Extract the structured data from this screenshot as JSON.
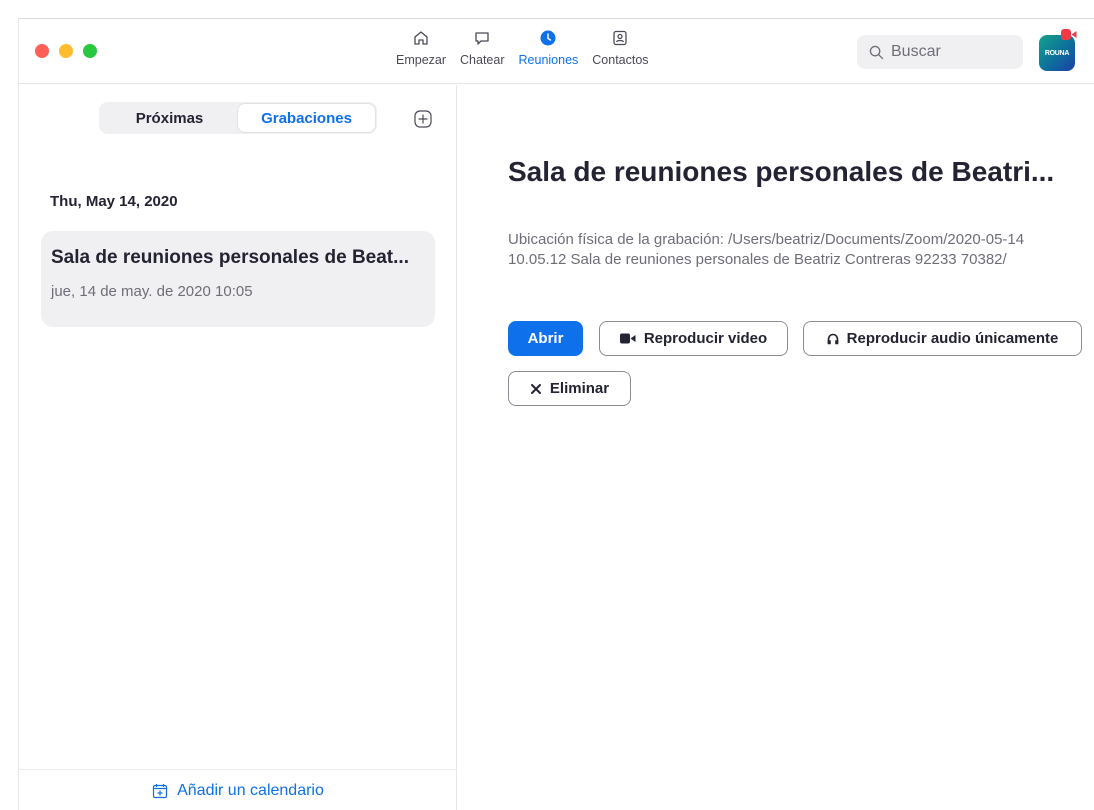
{
  "nav": {
    "items": [
      {
        "label": "Empezar",
        "icon": "home-icon"
      },
      {
        "label": "Chatear",
        "icon": "chat-bubble-icon"
      },
      {
        "label": "Reuniones",
        "icon": "clock-icon"
      },
      {
        "label": "Contactos",
        "icon": "contact-card-icon"
      }
    ],
    "active": "Reuniones"
  },
  "search": {
    "placeholder": "Buscar"
  },
  "avatar": {
    "text": "ROUNA"
  },
  "left": {
    "tabs": [
      "Próximas",
      "Grabaciones"
    ],
    "active_tab": "Grabaciones",
    "date_header": "Thu, May 14, 2020",
    "recording": {
      "title": "Sala de reuniones personales de Beat...",
      "datetime": "jue, 14 de may. de 2020 10:05"
    },
    "footer_label": "Añadir un calendario"
  },
  "detail": {
    "title": "Sala de reuniones personales de Beatri...",
    "location": "Ubicación física de la grabación: /Users/beatriz/Documents/Zoom/2020-05-14 10.05.12 Sala de reuniones personales de Beatriz Contreras 92233 70382/",
    "buttons": {
      "open": "Abrir",
      "play_video": "Reproducir video",
      "play_audio": "Reproducir audio únicamente",
      "delete": "Eliminar"
    }
  },
  "colors": {
    "accent": "#0e71eb",
    "text": "#232333",
    "muted": "#6e6e78",
    "panel": "#f0f0f2"
  }
}
